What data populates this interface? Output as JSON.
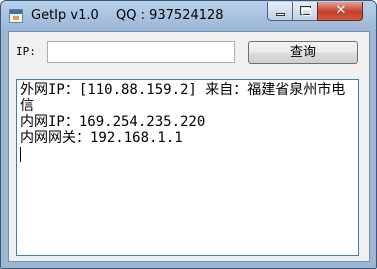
{
  "window": {
    "title": "GetIp v1.0",
    "qq": "QQ : 937524128"
  },
  "form": {
    "ip_label": "IP:",
    "ip_input_value": "",
    "query_label": "查询"
  },
  "result": {
    "lines": [
      "外网IP：[110.88.159.2] 来自：福建省泉州市电信",
      "内网IP：169.254.235.220",
      "内网网关：192.168.1.1"
    ]
  },
  "icons": {
    "app": "app-window-icon",
    "minimize": "minimize-icon",
    "maximize": "maximize-icon",
    "close": "close-icon"
  }
}
